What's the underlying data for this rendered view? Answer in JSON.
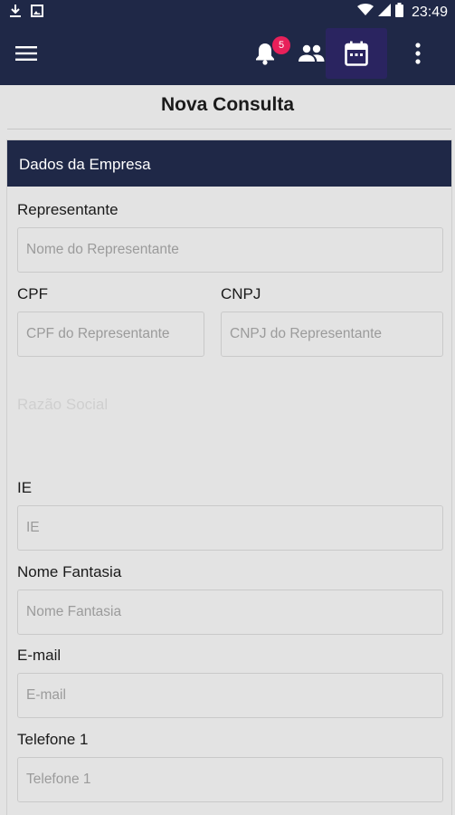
{
  "status_bar": {
    "time": "23:49"
  },
  "app_bar": {
    "notification_count": "5"
  },
  "page": {
    "title": "Nova Consulta"
  },
  "section": {
    "title": "Dados da Empresa"
  },
  "form": {
    "representante": {
      "label": "Representante",
      "placeholder": "Nome do Representante"
    },
    "cpf": {
      "label": "CPF",
      "placeholder": "CPF do Representante"
    },
    "cnpj": {
      "label": "CNPJ",
      "placeholder": "CNPJ do Representante"
    },
    "razao_social": {
      "label": "Razão Social"
    },
    "ie": {
      "label": "IE",
      "placeholder": "IE"
    },
    "nome_fantasia": {
      "label": "Nome Fantasia",
      "placeholder": "Nome Fantasia"
    },
    "email": {
      "label": "E-mail",
      "placeholder": "E-mail"
    },
    "telefone1": {
      "label": "Telefone 1",
      "placeholder": "Telefone 1"
    }
  },
  "colors": {
    "primary": "#1f2847",
    "badge": "#e8205a",
    "active_tab": "#2a2460",
    "background": "#e3e3e3"
  }
}
